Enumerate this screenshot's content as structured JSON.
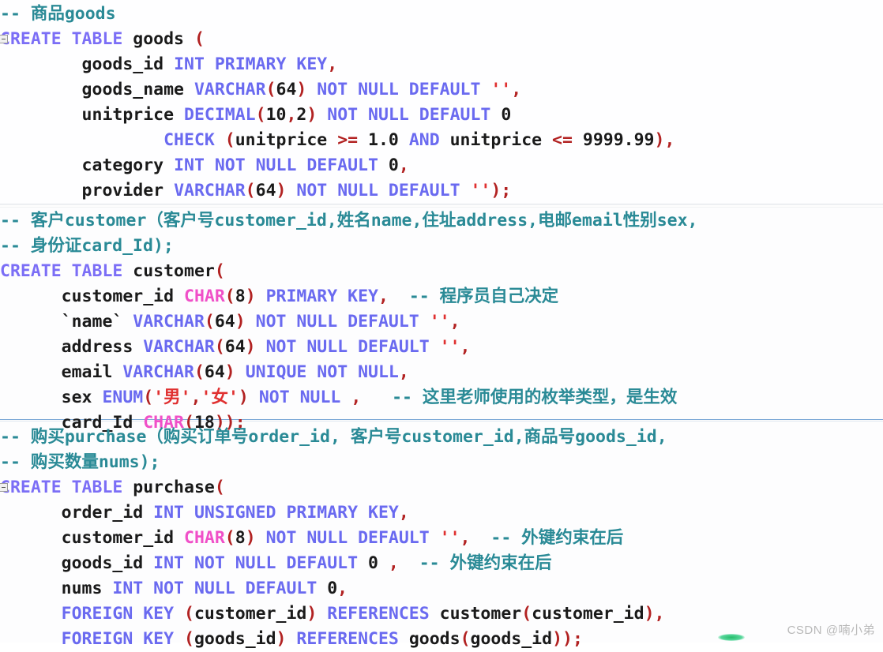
{
  "editor": {
    "watermark": "CSDN @喃小弟",
    "colors": {
      "keyword": "#6a6af0",
      "char_type": "#f050c8",
      "punctuation": "#b22222",
      "comment": "#2a8a96",
      "string": "#e03030",
      "identifier": "#1a1a1a",
      "background": "#fdfdfd",
      "separator_blue": "#7aa7d6"
    }
  },
  "blocks": [
    {
      "name": "goods-table",
      "lines": [
        {
          "id": "l1",
          "text": "-- 商品goods",
          "tokens": [
            {
              "t": "-- 商品goods",
              "c": "cmt"
            }
          ]
        },
        {
          "id": "l2",
          "fold": true,
          "text": "CREATE TABLE goods (",
          "tokens": [
            {
              "t": "CREATE TABLE ",
              "c": "kw2"
            },
            {
              "t": "goods ",
              "c": "id"
            },
            {
              "t": "(",
              "c": "pun"
            }
          ]
        },
        {
          "id": "l3",
          "text": "        goods_id INT PRIMARY KEY,",
          "tokens": [
            {
              "t": "        goods_id ",
              "c": "id"
            },
            {
              "t": "INT PRIMARY KEY",
              "c": "kw"
            },
            {
              "t": ",",
              "c": "pun"
            }
          ]
        },
        {
          "id": "l4",
          "text": "        goods_name VARCHAR(64) NOT NULL DEFAULT '',",
          "tokens": [
            {
              "t": "        goods_name ",
              "c": "id"
            },
            {
              "t": "VARCHAR",
              "c": "kw"
            },
            {
              "t": "(",
              "c": "pun"
            },
            {
              "t": "64",
              "c": "num"
            },
            {
              "t": ")",
              "c": "pun"
            },
            {
              "t": " NOT NULL DEFAULT ",
              "c": "kw"
            },
            {
              "t": "''",
              "c": "str"
            },
            {
              "t": ",",
              "c": "pun"
            }
          ]
        },
        {
          "id": "l5",
          "text": "        unitprice DECIMAL(10,2) NOT NULL DEFAULT 0",
          "tokens": [
            {
              "t": "        unitprice ",
              "c": "id"
            },
            {
              "t": "DECIMAL",
              "c": "kw"
            },
            {
              "t": "(",
              "c": "pun"
            },
            {
              "t": "10",
              "c": "num"
            },
            {
              "t": ",",
              "c": "pun"
            },
            {
              "t": "2",
              "c": "num"
            },
            {
              "t": ")",
              "c": "pun"
            },
            {
              "t": " NOT NULL DEFAULT ",
              "c": "kw"
            },
            {
              "t": "0",
              "c": "num"
            }
          ]
        },
        {
          "id": "l6",
          "text": "                CHECK (unitprice >= 1.0 AND unitprice <= 9999.99),",
          "tokens": [
            {
              "t": "                ",
              "c": "id"
            },
            {
              "t": "CHECK ",
              "c": "kw"
            },
            {
              "t": "(",
              "c": "pun"
            },
            {
              "t": "unitprice ",
              "c": "id"
            },
            {
              "t": ">=",
              "c": "op"
            },
            {
              "t": " 1.0 ",
              "c": "num"
            },
            {
              "t": "AND",
              "c": "kw"
            },
            {
              "t": " unitprice ",
              "c": "id"
            },
            {
              "t": "<=",
              "c": "op"
            },
            {
              "t": " 9999.99",
              "c": "num"
            },
            {
              "t": "),",
              "c": "pun"
            }
          ]
        },
        {
          "id": "l7",
          "text": "        category INT NOT NULL DEFAULT 0,",
          "tokens": [
            {
              "t": "        category ",
              "c": "id"
            },
            {
              "t": "INT NOT NULL DEFAULT ",
              "c": "kw"
            },
            {
              "t": "0",
              "c": "num"
            },
            {
              "t": ",",
              "c": "pun"
            }
          ]
        },
        {
          "id": "l8",
          "text": "        provider VARCHAR(64) NOT NULL DEFAULT '');",
          "tokens": [
            {
              "t": "        provider ",
              "c": "id"
            },
            {
              "t": "VARCHAR",
              "c": "kw"
            },
            {
              "t": "(",
              "c": "pun"
            },
            {
              "t": "64",
              "c": "num"
            },
            {
              "t": ")",
              "c": "pun"
            },
            {
              "t": " NOT NULL DEFAULT ",
              "c": "kw"
            },
            {
              "t": "''",
              "c": "str"
            },
            {
              "t": ");",
              "c": "pun"
            }
          ]
        }
      ]
    },
    {
      "name": "customer-table",
      "lines": [
        {
          "id": "l9",
          "text": "-- 客户customer（客户号customer_id,姓名name,住址address,电邮email性别sex,",
          "tokens": [
            {
              "t": "-- 客户customer（客户号customer_id,姓名name,住址address,电邮email性别sex,",
              "c": "cmt"
            }
          ]
        },
        {
          "id": "l10",
          "text": "-- 身份证card_Id);",
          "tokens": [
            {
              "t": "-- 身份证card_Id);",
              "c": "cmt"
            }
          ]
        },
        {
          "id": "l11",
          "text": "CREATE TABLE customer(",
          "tokens": [
            {
              "t": "CREATE TABLE ",
              "c": "kw2"
            },
            {
              "t": "customer",
              "c": "id"
            },
            {
              "t": "(",
              "c": "pun"
            }
          ]
        },
        {
          "id": "l12",
          "text": "      customer_id CHAR(8) PRIMARY KEY,  -- 程序员自己决定",
          "tokens": [
            {
              "t": "      customer_id ",
              "c": "id"
            },
            {
              "t": "CHAR",
              "c": "type-char"
            },
            {
              "t": "(",
              "c": "pun"
            },
            {
              "t": "8",
              "c": "num"
            },
            {
              "t": ")",
              "c": "pun"
            },
            {
              "t": " PRIMARY KEY",
              "c": "kw"
            },
            {
              "t": ",",
              "c": "pun"
            },
            {
              "t": "  -- 程序员自己决定",
              "c": "cmt"
            }
          ]
        },
        {
          "id": "l13",
          "text": "      `name` VARCHAR(64) NOT NULL DEFAULT '',",
          "tokens": [
            {
              "t": "      `name` ",
              "c": "id"
            },
            {
              "t": "VARCHAR",
              "c": "kw"
            },
            {
              "t": "(",
              "c": "pun"
            },
            {
              "t": "64",
              "c": "num"
            },
            {
              "t": ")",
              "c": "pun"
            },
            {
              "t": " NOT NULL DEFAULT ",
              "c": "kw"
            },
            {
              "t": "''",
              "c": "str"
            },
            {
              "t": ",",
              "c": "pun"
            }
          ]
        },
        {
          "id": "l14",
          "text": "      address VARCHAR(64) NOT NULL DEFAULT '',",
          "tokens": [
            {
              "t": "      address ",
              "c": "id"
            },
            {
              "t": "VARCHAR",
              "c": "kw"
            },
            {
              "t": "(",
              "c": "pun"
            },
            {
              "t": "64",
              "c": "num"
            },
            {
              "t": ")",
              "c": "pun"
            },
            {
              "t": " NOT NULL DEFAULT ",
              "c": "kw"
            },
            {
              "t": "''",
              "c": "str"
            },
            {
              "t": ",",
              "c": "pun"
            }
          ]
        },
        {
          "id": "l15",
          "text": "      email VARCHAR(64) UNIQUE NOT NULL,",
          "tokens": [
            {
              "t": "      email ",
              "c": "id"
            },
            {
              "t": "VARCHAR",
              "c": "kw"
            },
            {
              "t": "(",
              "c": "pun"
            },
            {
              "t": "64",
              "c": "num"
            },
            {
              "t": ")",
              "c": "pun"
            },
            {
              "t": " UNIQUE NOT NULL",
              "c": "kw"
            },
            {
              "t": ",",
              "c": "pun"
            }
          ]
        },
        {
          "id": "l16",
          "text": "      sex ENUM('男','女') NOT NULL ,   -- 这里老师使用的枚举类型，是生效",
          "tokens": [
            {
              "t": "      sex ",
              "c": "id"
            },
            {
              "t": "ENUM",
              "c": "kw"
            },
            {
              "t": "(",
              "c": "pun"
            },
            {
              "t": "'男'",
              "c": "str"
            },
            {
              "t": ",",
              "c": "pun"
            },
            {
              "t": "'女'",
              "c": "str"
            },
            {
              "t": ")",
              "c": "pun"
            },
            {
              "t": " NOT NULL",
              "c": "kw"
            },
            {
              "t": " ,",
              "c": "pun"
            },
            {
              "t": "   -- 这里老师使用的枚举类型，是生效",
              "c": "cmt"
            }
          ]
        },
        {
          "id": "l17",
          "text": "      card_Id CHAR(18));",
          "tokens": [
            {
              "t": "      card_Id ",
              "c": "id"
            },
            {
              "t": "CHAR",
              "c": "type-char"
            },
            {
              "t": "(",
              "c": "pun"
            },
            {
              "t": "18",
              "c": "num"
            },
            {
              "t": "));",
              "c": "pun"
            }
          ]
        }
      ]
    },
    {
      "name": "purchase-table",
      "lines": [
        {
          "id": "l18",
          "text": "-- 购买purchase（购买订单号order_id, 客户号customer_id,商品号goods_id,",
          "tokens": [
            {
              "t": "-- 购买purchase（购买订单号order_id, 客户号customer_id,商品号goods_id,",
              "c": "cmt"
            }
          ]
        },
        {
          "id": "l19",
          "text": "-- 购买数量nums);",
          "tokens": [
            {
              "t": "-- 购买数量nums);",
              "c": "cmt"
            }
          ]
        },
        {
          "id": "l20",
          "fold": true,
          "text": "CREATE TABLE purchase(",
          "tokens": [
            {
              "t": "CREATE TABLE ",
              "c": "kw2"
            },
            {
              "t": "purchase",
              "c": "id"
            },
            {
              "t": "(",
              "c": "pun"
            }
          ]
        },
        {
          "id": "l21",
          "text": "      order_id INT UNSIGNED PRIMARY KEY,",
          "tokens": [
            {
              "t": "      order_id ",
              "c": "id"
            },
            {
              "t": "INT UNSIGNED PRIMARY KEY",
              "c": "kw"
            },
            {
              "t": ",",
              "c": "pun"
            }
          ]
        },
        {
          "id": "l22",
          "text": "      customer_id CHAR(8) NOT NULL DEFAULT '',  -- 外键约束在后",
          "tokens": [
            {
              "t": "      customer_id ",
              "c": "id"
            },
            {
              "t": "CHAR",
              "c": "type-char"
            },
            {
              "t": "(",
              "c": "pun"
            },
            {
              "t": "8",
              "c": "num"
            },
            {
              "t": ")",
              "c": "pun"
            },
            {
              "t": " NOT NULL DEFAULT ",
              "c": "kw"
            },
            {
              "t": "''",
              "c": "str"
            },
            {
              "t": ",",
              "c": "pun"
            },
            {
              "t": "  -- 外键约束在后",
              "c": "cmt"
            }
          ]
        },
        {
          "id": "l23",
          "text": "      goods_id INT NOT NULL DEFAULT 0 ,  -- 外键约束在后",
          "tokens": [
            {
              "t": "      goods_id ",
              "c": "id"
            },
            {
              "t": "INT NOT NULL DEFAULT ",
              "c": "kw"
            },
            {
              "t": "0",
              "c": "num"
            },
            {
              "t": " ,",
              "c": "pun"
            },
            {
              "t": "  -- 外键约束在后",
              "c": "cmt"
            }
          ]
        },
        {
          "id": "l24",
          "text": "      nums INT NOT NULL DEFAULT 0,",
          "tokens": [
            {
              "t": "      nums ",
              "c": "id"
            },
            {
              "t": "INT NOT NULL DEFAULT ",
              "c": "kw"
            },
            {
              "t": "0",
              "c": "num"
            },
            {
              "t": ",",
              "c": "pun"
            }
          ]
        },
        {
          "id": "l25",
          "text": "      FOREIGN KEY (customer_id) REFERENCES customer(customer_id),",
          "tokens": [
            {
              "t": "      ",
              "c": "id"
            },
            {
              "t": "FOREIGN KEY ",
              "c": "kw"
            },
            {
              "t": "(",
              "c": "pun"
            },
            {
              "t": "customer_id",
              "c": "id"
            },
            {
              "t": ")",
              "c": "pun"
            },
            {
              "t": " REFERENCES ",
              "c": "kw"
            },
            {
              "t": "customer",
              "c": "id"
            },
            {
              "t": "(",
              "c": "pun"
            },
            {
              "t": "customer_id",
              "c": "id"
            },
            {
              "t": "),",
              "c": "pun"
            }
          ]
        },
        {
          "id": "l26",
          "text": "      FOREIGN KEY (goods_id) REFERENCES goods(goods_id));",
          "tokens": [
            {
              "t": "      ",
              "c": "id"
            },
            {
              "t": "FOREIGN KEY ",
              "c": "kw"
            },
            {
              "t": "(",
              "c": "pun"
            },
            {
              "t": "goods_id",
              "c": "id"
            },
            {
              "t": ")",
              "c": "pun"
            },
            {
              "t": " REFERENCES ",
              "c": "kw"
            },
            {
              "t": "goods",
              "c": "id"
            },
            {
              "t": "(",
              "c": "pun"
            },
            {
              "t": "goods_id",
              "c": "id"
            },
            {
              "t": "));",
              "c": "pun"
            }
          ]
        }
      ]
    }
  ]
}
